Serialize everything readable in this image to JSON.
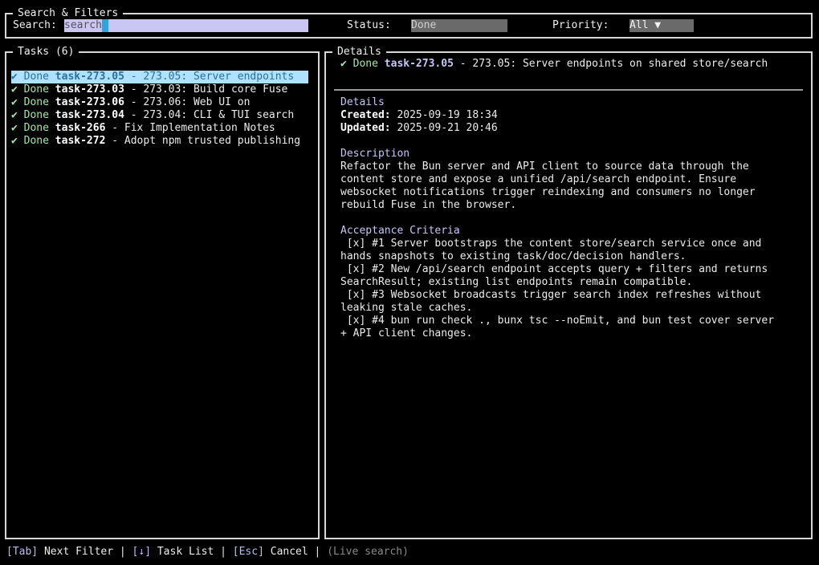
{
  "filters": {
    "title": "Search & Filters",
    "search_label": "Search:",
    "search_value": "search",
    "status_label": "Status:",
    "status_value": "Done",
    "priority_label": "Priority:",
    "priority_value": "All ▼"
  },
  "tasks": {
    "title": "Tasks (6)",
    "items": [
      {
        "check": "✔",
        "status": "Done",
        "id": "task-273.05",
        "title": "- 273.05: Server endpoints",
        "selected": true
      },
      {
        "check": "✔",
        "status": "Done",
        "id": "task-273.03",
        "title": "- 273.03: Build core Fuse",
        "selected": false
      },
      {
        "check": "✔",
        "status": "Done",
        "id": "task-273.06",
        "title": "- 273.06: Web UI on",
        "selected": false
      },
      {
        "check": "✔",
        "status": "Done",
        "id": "task-273.04",
        "title": "- 273.04: CLI & TUI search",
        "selected": false
      },
      {
        "check": "✔",
        "status": "Done",
        "id": "task-266",
        "title": "- Fix Implementation Notes",
        "selected": false
      },
      {
        "check": "✔",
        "status": "Done",
        "id": "task-272",
        "title": "- Adopt npm trusted publishing",
        "selected": false
      }
    ]
  },
  "details": {
    "title": "Details",
    "header_check": "✔",
    "header_status": "Done",
    "header_id": "task-273.05",
    "header_title": "- 273.05: Server endpoints on shared store/search",
    "section_details": "Details",
    "created_label": "Created:",
    "created_value": "2025-09-19 18:34",
    "updated_label": "Updated:",
    "updated_value": "2025-09-21 20:46",
    "section_description": "Description",
    "description_lines": [
      "Refactor the Bun server and API client to source data through the",
      "content store and expose a unified /api/search endpoint. Ensure",
      "websocket notifications trigger reindexing and consumers no longer",
      "rebuild Fuse in the browser."
    ],
    "section_acceptance": "Acceptance Criteria",
    "acceptance_lines": [
      " [x] #1 Server bootstraps the content store/search service once and",
      "hands snapshots to existing task/doc/decision handlers.",
      " [x] #2 New /api/search endpoint accepts query + filters and returns",
      "SearchResult; existing list endpoints remain compatible.",
      " [x] #3 Websocket broadcasts trigger search index refreshes without",
      "leaking stale caches.",
      " [x] #4 bun run check ., bunx tsc --noEmit, and bun test cover server",
      "+ API client changes."
    ]
  },
  "footer": {
    "tab_key": "[Tab]",
    "tab_label": " Next Filter ",
    "sep1": "|",
    "down_key": " [↓]",
    "down_label": " Task List ",
    "sep2": "|",
    "esc_key": " [Esc]",
    "esc_label": " Cancel ",
    "sep3": "|",
    "live": " (Live search)"
  }
}
